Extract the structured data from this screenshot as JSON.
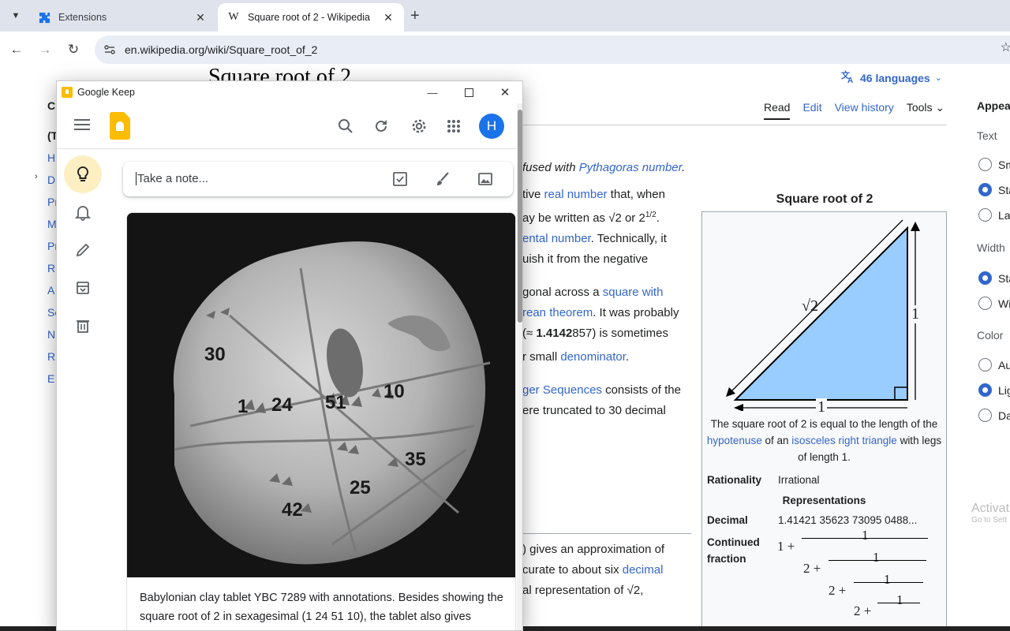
{
  "browser": {
    "tabs": [
      {
        "title": "Extensions",
        "active": false
      },
      {
        "title": "Square root of 2 - Wikipedia",
        "active": true
      }
    ],
    "url": "en.wikipedia.org/wiki/Square_root_of_2"
  },
  "wiki": {
    "title": "Square root of 2",
    "languages": "46 languages",
    "tabs": {
      "read": "Read",
      "edit": "Edit",
      "history": "View history",
      "tools": "Tools"
    },
    "toc_letters": [
      "C",
      "(T",
      "H",
      "D",
      "Pr",
      "M",
      "Pr",
      "R",
      "A",
      "Se",
      "N",
      "R",
      "E"
    ],
    "body_lines": [
      {
        "pre": "",
        "link": "",
        "text": "fused with ",
        "link2": "Pythagoras number",
        "post": ".",
        "italic": true
      },
      {
        "pre": "tive ",
        "link": "real number",
        "text": " that, when",
        "link2": "",
        "post": ""
      },
      {
        "pre": "ay be written as √2 or 2",
        "link": "",
        "text": "1/2",
        "link2": "",
        "post": ".",
        "sup": true
      },
      {
        "pre": "",
        "link": "ental number",
        "text": ". Technically, it",
        "link2": "",
        "post": ""
      },
      {
        "pre": "uish it from the negative",
        "link": "",
        "text": "",
        "link2": "",
        "post": ""
      },
      {
        "pre": "",
        "link": "",
        "text": "",
        "link2": "",
        "post": ""
      },
      {
        "pre": "gonal across a ",
        "link": "square with",
        "text": "",
        "link2": "",
        "post": ""
      },
      {
        "pre": "",
        "link": "rean theorem",
        "text": ". It was probably",
        "link2": "",
        "post": ""
      },
      {
        "pre": "(≈ ",
        "link": "",
        "text": "1.4142",
        "link2": "",
        "post": "857) is sometimes",
        "bold": true
      },
      {
        "pre": "r small ",
        "link": "denominator",
        "text": ".",
        "link2": "",
        "post": ""
      },
      {
        "pre": "",
        "link": "",
        "text": "",
        "link2": "",
        "post": ""
      },
      {
        "pre": "",
        "link": "ger Sequences",
        "text": " consists of the",
        "link2": "",
        "post": ""
      },
      {
        "pre": "ere truncated to 30 decimal",
        "link": "",
        "text": "",
        "link2": "",
        "post": ""
      }
    ],
    "body_lines_lower": [
      {
        "pre": ") gives an approximation of",
        "link": "",
        "text": ""
      },
      {
        "pre": "curate to about six ",
        "link": "decimal",
        "text": ""
      },
      {
        "pre": "al representation of √2,",
        "link": "",
        "text": ""
      }
    ],
    "infobox": {
      "title": "Square root of 2",
      "diagram_labels": {
        "hyp": "√2",
        "side": "1",
        "base": "1"
      },
      "caption_pre": "The square root of 2 is equal to the length of the ",
      "caption_link1": "hypotenuse",
      "caption_mid": " of an ",
      "caption_link2": "isosceles right triangle",
      "caption_post": " with legs of length 1.",
      "rationality_label": "Rationality",
      "rationality_value": "Irrational",
      "representations": "Representations",
      "decimal_label": "Decimal",
      "decimal_value": "1.41421 35623 73095 0488...",
      "cf_label": "Continued fraction",
      "cf_terms": [
        "1 +",
        "1",
        "2 +",
        "1",
        "2 +",
        "1",
        "2 +",
        "1"
      ]
    },
    "appearance": {
      "heading": "Appea",
      "text_label": "Text",
      "text_opts": [
        "Sm",
        "Sta",
        "Lar"
      ],
      "text_selected": 1,
      "width_label": "Width",
      "width_opts": [
        "Sta",
        "Wi"
      ],
      "width_selected": 0,
      "color_label": "Color",
      "color_opts": [
        "Au",
        "Lig",
        "Da"
      ],
      "color_selected": 1
    },
    "activate": {
      "line1": "Activat",
      "line2": "Go to Sett"
    }
  },
  "keep": {
    "window_title": "Google Keep",
    "avatar_letter": "H",
    "note_placeholder": "Take a note...",
    "image_numbers": [
      "30",
      "1",
      "24",
      "51",
      "10",
      "35",
      "25",
      "42"
    ],
    "note_text": "Babylonian clay tablet YBC 7289 with annotations. Besides showing the square root of 2 in sexagesimal (1 24 51 10), the tablet also gives",
    "accent": "#fbbc04",
    "avatar_color": "#1a73e8"
  }
}
